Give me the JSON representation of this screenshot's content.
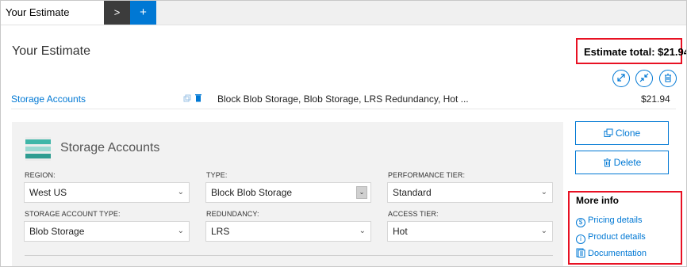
{
  "tabs": {
    "active": "Your Estimate",
    "next": ">",
    "add": "+"
  },
  "page": {
    "title": "Your Estimate",
    "estimate_total": "Estimate total: $21.94"
  },
  "row": {
    "name": "Storage Accounts",
    "description": "Block Blob Storage, Blob Storage, LRS Redundancy, Hot ...",
    "price": "$21.94"
  },
  "panel": {
    "title": "Storage Accounts",
    "fields": [
      {
        "label": "REGION:",
        "value": "West US"
      },
      {
        "label": "TYPE:",
        "value": "Block Blob Storage"
      },
      {
        "label": "PERFORMANCE TIER:",
        "value": "Standard"
      },
      {
        "label": "STORAGE ACCOUNT TYPE:",
        "value": "Blob Storage"
      },
      {
        "label": "REDUNDANCY:",
        "value": "LRS"
      },
      {
        "label": "ACCESS TIER:",
        "value": "Hot"
      }
    ]
  },
  "actions": {
    "clone": "Clone",
    "delete": "Delete"
  },
  "more_info": {
    "title": "More info",
    "links": [
      "Pricing details",
      "Product details",
      "Documentation"
    ]
  },
  "colors": {
    "accent": "#0078d4",
    "highlight": "#e81123",
    "tab_dark": "#3c3c3c",
    "panel_bg": "#f2f2f2"
  },
  "icons": [
    "expand-icon",
    "collapse-icon",
    "trash-icon",
    "clone-icon",
    "dollar-icon",
    "info-icon",
    "document-icon"
  ]
}
